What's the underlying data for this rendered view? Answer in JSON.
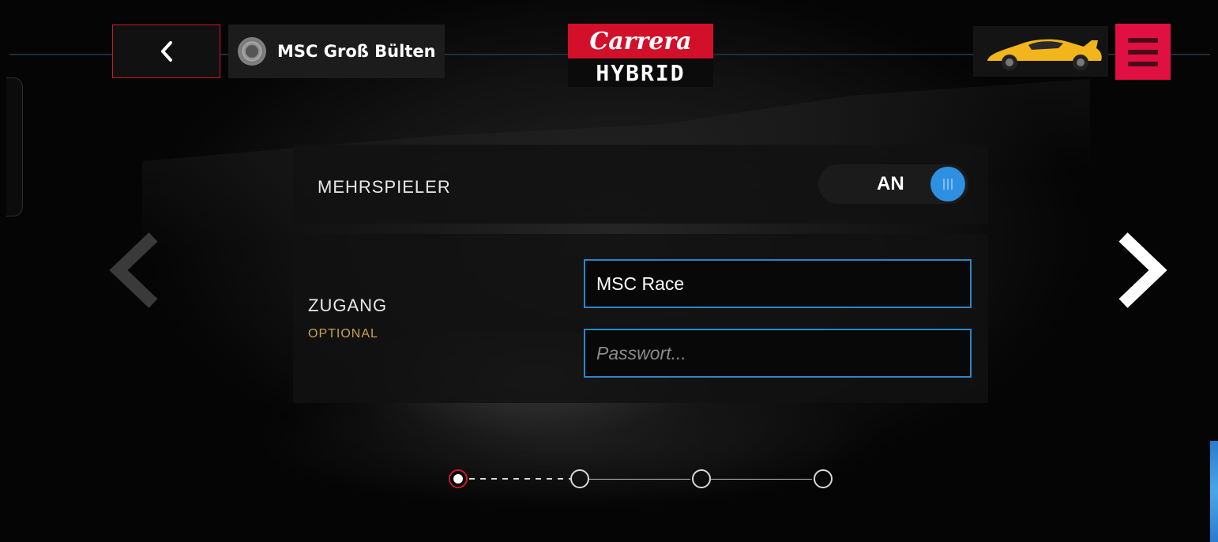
{
  "header": {
    "back_icon": "chevron-left-icon",
    "track_name": "MSC Groß Bülten",
    "logo_top": "Carrera",
    "logo_bottom": "HYBRID",
    "menu_icon": "hamburger-icon"
  },
  "multiplayer": {
    "label": "MEHRSPIELER",
    "toggle_text": "AN",
    "toggle_on": true
  },
  "access": {
    "label": "ZUGANG",
    "sublabel": "OPTIONAL",
    "username_value": "MSC Race",
    "password_placeholder": "Passwort..."
  },
  "stepper": {
    "steps": 4,
    "current": 1
  },
  "colors": {
    "accent_red": "#d0142f",
    "menu_pink": "#e01043",
    "field_border": "#2b86c7",
    "toggle_blue": "#2f8fe0",
    "optional_gold": "#c9a24a"
  }
}
